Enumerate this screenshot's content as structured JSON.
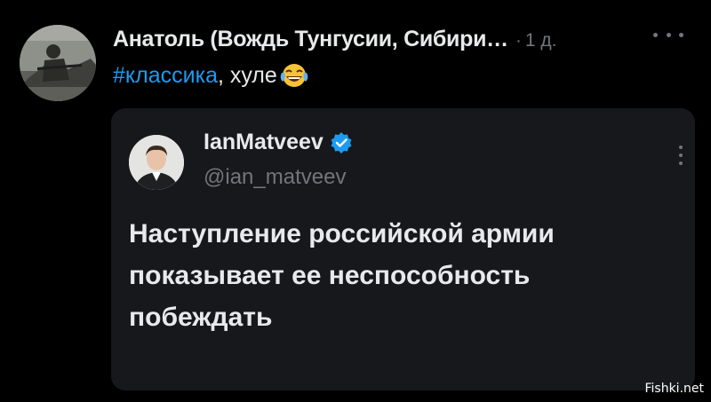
{
  "post": {
    "author_name": "Анатоль (Вождь Тунгусии, Сибири",
    "author_ellipsis": "…",
    "separator": "·",
    "time": "1 д.",
    "hashtag": "#классика",
    "text": ", хуле",
    "emoji": "face-with-tears-of-joy"
  },
  "quote": {
    "name": "IanMatveev",
    "handle": "@ian_matveev",
    "verified": true,
    "text_lines": [
      "Наступление российской армии",
      "показывает ее неспособность",
      "побеждать"
    ]
  },
  "watermark": "Fishki.net",
  "colors": {
    "background": "#000000",
    "card": "#16181c",
    "text": "#e7e9ea",
    "muted": "#71767b",
    "accent": "#1d9bf0"
  }
}
